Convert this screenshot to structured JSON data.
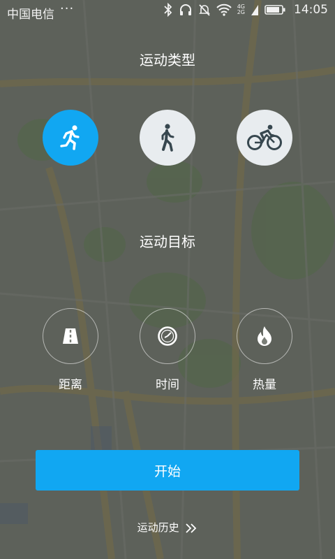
{
  "status_bar": {
    "carrier": "中国电信",
    "more": "···",
    "net_top": "4G",
    "net_bottom": "2G",
    "time": "14:05"
  },
  "sport_type": {
    "title": "运动类型",
    "options": [
      {
        "icon": "running-icon",
        "selected": true
      },
      {
        "icon": "walking-icon",
        "selected": false
      },
      {
        "icon": "cycling-icon",
        "selected": false
      }
    ]
  },
  "sport_goal": {
    "title": "运动目标",
    "options": [
      {
        "label": "距离",
        "icon": "road-icon"
      },
      {
        "label": "时间",
        "icon": "clock-icon"
      },
      {
        "label": "热量",
        "icon": "flame-icon"
      }
    ]
  },
  "start_label": "开始",
  "history_label": "运动历史",
  "colors": {
    "accent": "#11a7f2",
    "inactive_circle": "#e8ecef",
    "icon_dark": "#37474f"
  }
}
